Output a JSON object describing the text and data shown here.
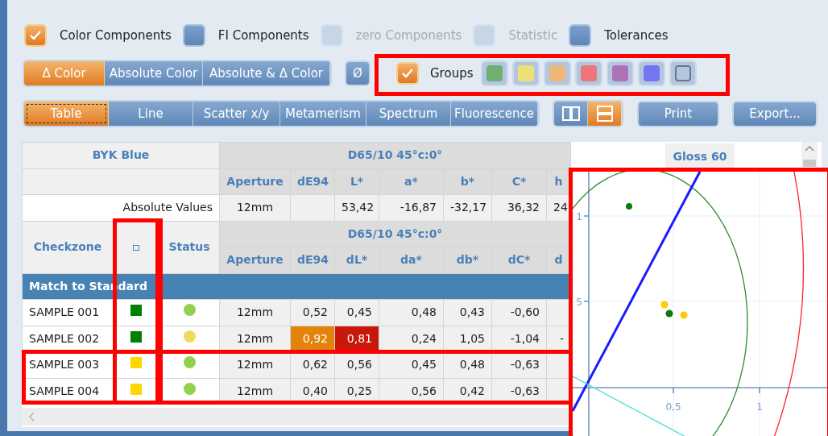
{
  "option_checks": [
    {
      "label": "Color Components",
      "checked": true,
      "disabled": false
    },
    {
      "label": "FI Components",
      "checked": false,
      "disabled": false
    },
    {
      "label": "zero Components",
      "checked": false,
      "disabled": true
    },
    {
      "label": "Statistic",
      "checked": false,
      "disabled": true
    },
    {
      "label": "Tolerances",
      "checked": false,
      "disabled": false
    }
  ],
  "color_modes": [
    {
      "label": "Δ Color",
      "selected": true
    },
    {
      "label": "Absolute Color",
      "selected": false
    },
    {
      "label": "Absolute & Δ Color",
      "selected": false
    }
  ],
  "empty_set_button": {
    "label": "Ø"
  },
  "groups": {
    "label": "Groups",
    "checked": true,
    "swatches": [
      {
        "kind": "color",
        "color": "#6db070"
      },
      {
        "kind": "color",
        "color": "#ede076"
      },
      {
        "kind": "color",
        "color": "#efb679"
      },
      {
        "kind": "color",
        "color": "#ee767b"
      },
      {
        "kind": "color",
        "color": "#ad72b8"
      },
      {
        "kind": "color",
        "color": "#7375f2"
      },
      {
        "kind": "blank"
      }
    ]
  },
  "view_tabs": [
    {
      "label": "Table",
      "selected": true
    },
    {
      "label": "Line",
      "selected": false
    },
    {
      "label": "Scatter x/y",
      "selected": false
    },
    {
      "label": "Metamerism",
      "selected": false
    },
    {
      "label": "Spectrum",
      "selected": false
    },
    {
      "label": "Fluorescence",
      "selected": false
    }
  ],
  "layout_toggle": [
    {
      "kind": "columns",
      "selected": false
    },
    {
      "kind": "rows",
      "selected": true
    }
  ],
  "buttons": [
    "Print",
    "Export..."
  ],
  "table": {
    "standard": "BYK Blue",
    "illuminant": "D65/10  45°c:0°",
    "columns": [
      "Aperture",
      "dE94",
      "L*",
      "a*",
      "b*",
      "C*",
      "h"
    ],
    "absolute_row": {
      "label": "Absolute Values",
      "values": [
        {
          "kind": "value",
          "text": "12mm"
        },
        {
          "kind": "blank"
        },
        {
          "kind": "value",
          "text": "53,42"
        },
        {
          "kind": "value",
          "text": "-16,87"
        },
        {
          "kind": "value",
          "text": "-32,17"
        },
        {
          "kind": "value",
          "text": "36,32"
        },
        {
          "kind": "value",
          "text": "24"
        }
      ]
    },
    "delta_header": {
      "checkzone": "Checkzone",
      "status": "Status",
      "illuminant": "D65/10  45°c:0°",
      "columns": [
        "Aperture",
        "dE94",
        "dL*",
        "da*",
        "db*",
        "dC*",
        "d"
      ]
    },
    "group_row": "Match to Standard",
    "rows": [
      {
        "name": "SAMPLE 001",
        "marker": {
          "color": "#008000"
        },
        "status": {
          "color": "#92d050"
        },
        "cells": [
          {
            "kind": "value",
            "text": "12mm"
          },
          {
            "kind": "value",
            "text": "0,52"
          },
          {
            "kind": "value",
            "text": "0,45"
          },
          {
            "kind": "value",
            "text": "0,48"
          },
          {
            "kind": "value",
            "text": "0,43"
          },
          {
            "kind": "value",
            "text": "-0,60"
          },
          {
            "kind": "blank"
          }
        ]
      },
      {
        "name": "SAMPLE 002",
        "marker": {
          "color": "#008000"
        },
        "status": {
          "color": "#f0da5a"
        },
        "cells": [
          {
            "kind": "value",
            "text": "12mm"
          },
          {
            "kind": "value",
            "text": "0,92",
            "color": "#e3830a"
          },
          {
            "kind": "value",
            "text": "0,81",
            "color": "#c8170b"
          },
          {
            "kind": "value",
            "text": "0,24"
          },
          {
            "kind": "value",
            "text": "1,05"
          },
          {
            "kind": "value",
            "text": "-1,04"
          },
          {
            "kind": "value",
            "text": "-"
          }
        ]
      },
      {
        "name": "SAMPLE 003",
        "marker": {
          "color": "#ffd700"
        },
        "status": {
          "color": "#92d050"
        },
        "cells": [
          {
            "kind": "value",
            "text": "12mm"
          },
          {
            "kind": "value",
            "text": "0,62"
          },
          {
            "kind": "value",
            "text": "0,56"
          },
          {
            "kind": "value",
            "text": "0,45"
          },
          {
            "kind": "value",
            "text": "0,48"
          },
          {
            "kind": "value",
            "text": "-0,63"
          },
          {
            "kind": "blank"
          }
        ]
      },
      {
        "name": "SAMPLE 004",
        "marker": {
          "color": "#ffd700"
        },
        "status": {
          "color": "#92d050"
        },
        "cells": [
          {
            "kind": "value",
            "text": "12mm"
          },
          {
            "kind": "value",
            "text": "0,40"
          },
          {
            "kind": "value",
            "text": "0,25"
          },
          {
            "kind": "value",
            "text": "0,56"
          },
          {
            "kind": "value",
            "text": "0,42"
          },
          {
            "kind": "value",
            "text": "-0,63"
          },
          {
            "kind": "blank"
          }
        ]
      }
    ],
    "gloss_header": "Gloss 60"
  },
  "inset_plot": {
    "y_ticks": [
      "1",
      "5"
    ],
    "x_ticks": [
      "0,5",
      "1"
    ]
  }
}
